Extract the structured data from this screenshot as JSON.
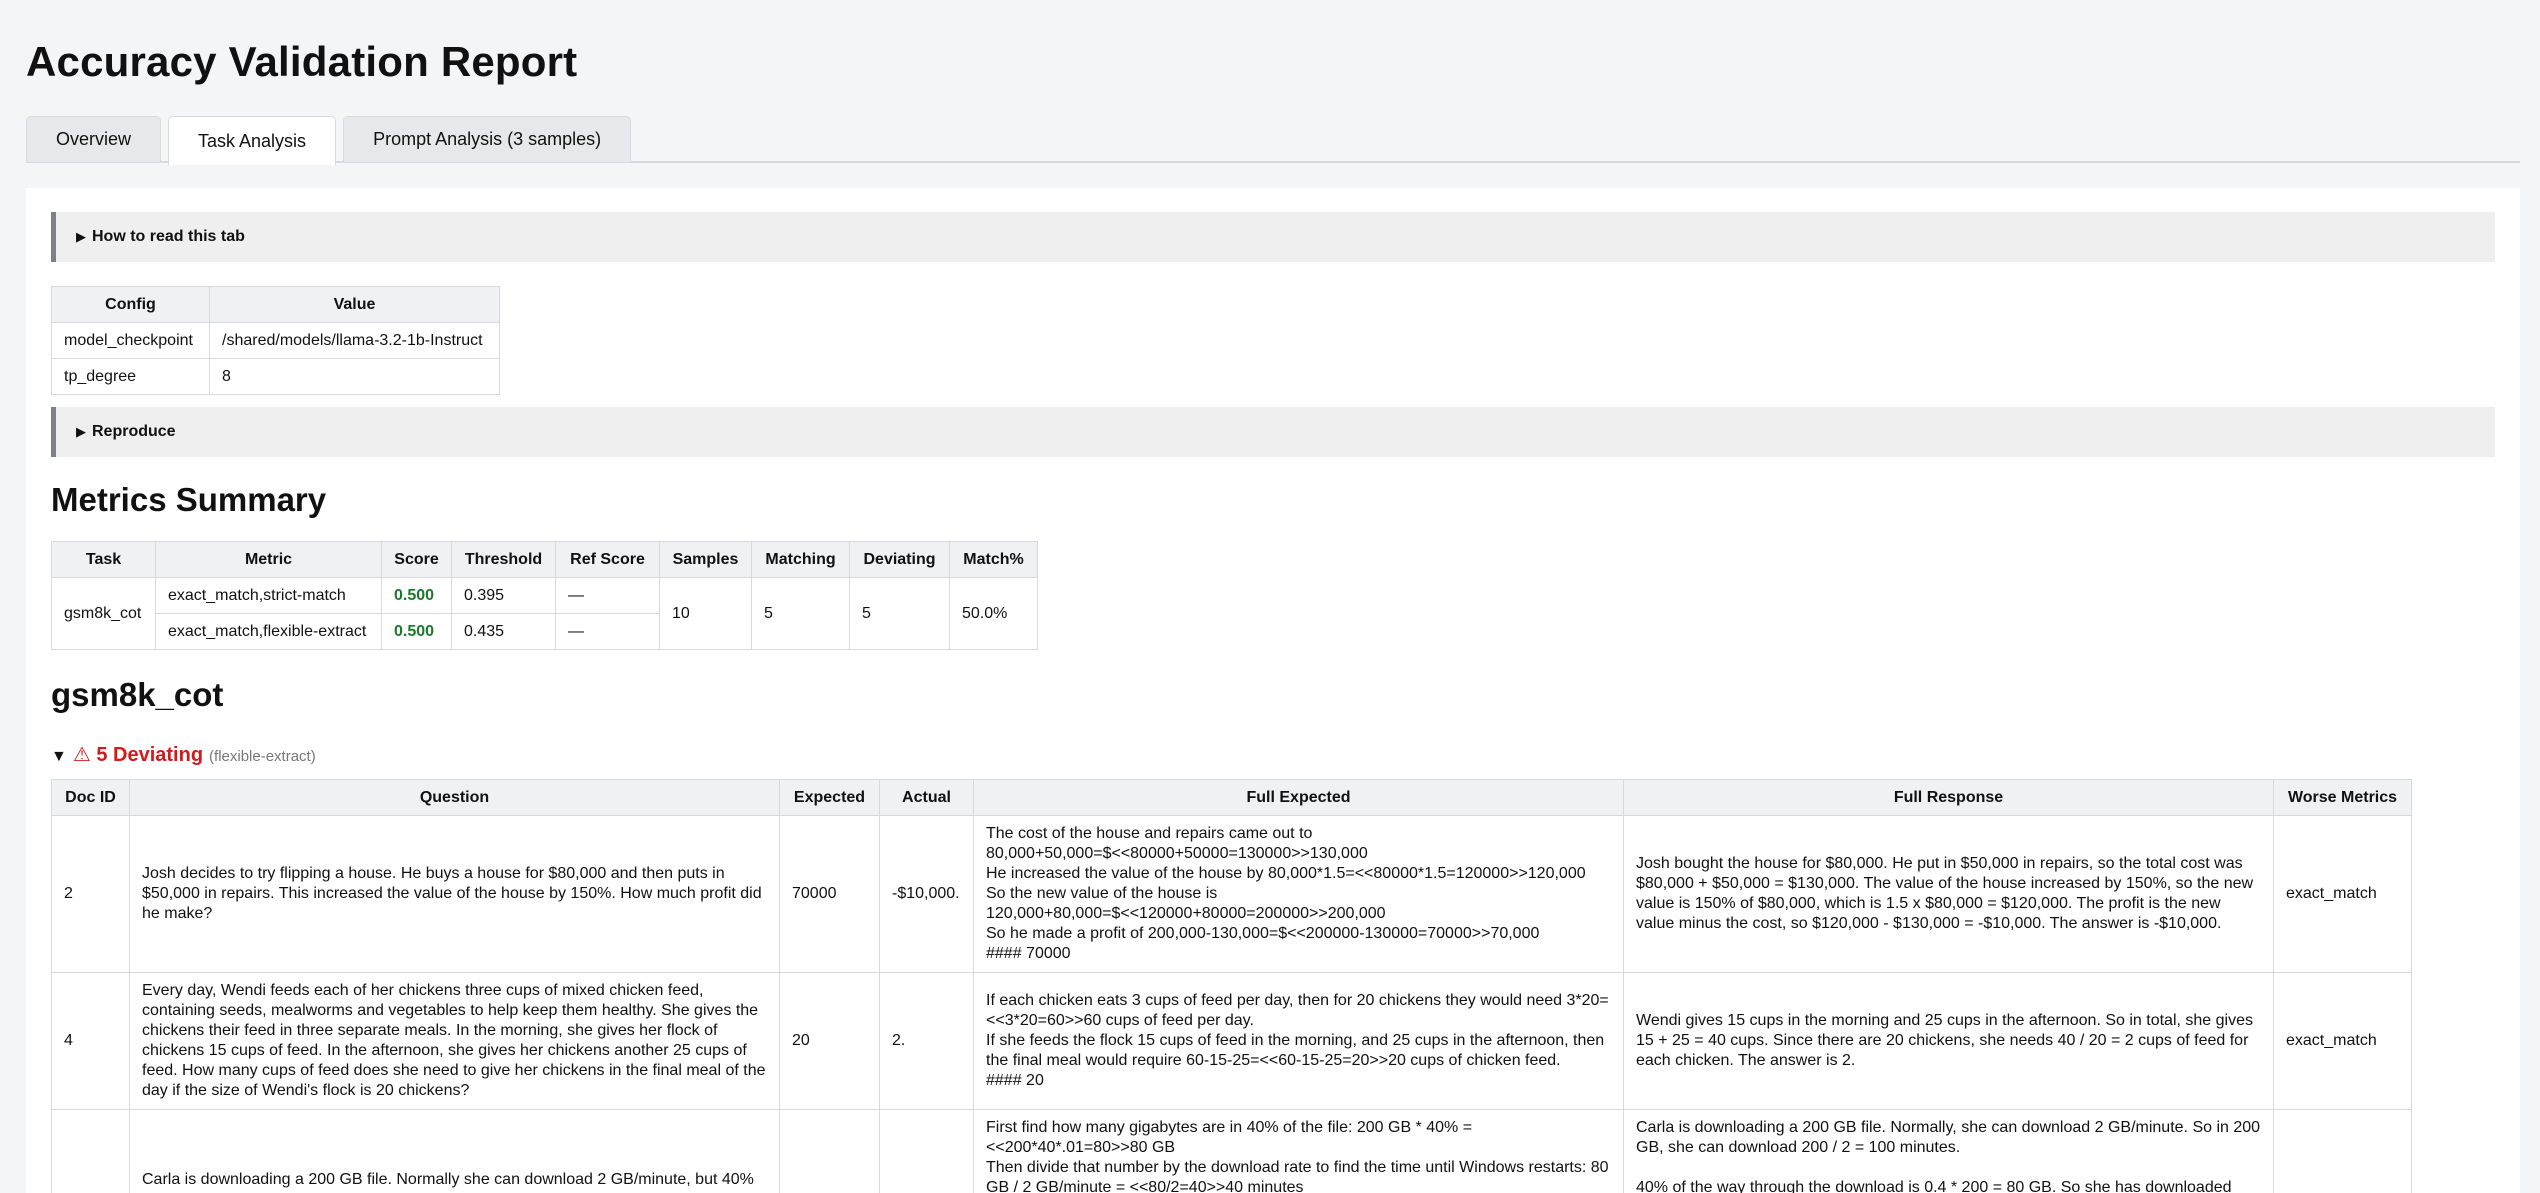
{
  "title": "Accuracy Validation Report",
  "tabs": [
    {
      "label": "Overview"
    },
    {
      "label": "Task Analysis"
    },
    {
      "label": "Prompt Analysis (3 samples)"
    }
  ],
  "how_to_read": {
    "arrow": "▶",
    "label": "How to read this tab"
  },
  "config": {
    "headers": [
      "Config",
      "Value"
    ],
    "rows": [
      {
        "key": "model_checkpoint",
        "value": "/shared/models/llama-3.2-1b-Instruct"
      },
      {
        "key": "tp_degree",
        "value": "8"
      }
    ]
  },
  "reproduce": {
    "arrow": "▶",
    "label": "Reproduce"
  },
  "metrics": {
    "title": "Metrics Summary",
    "headers": [
      "Task",
      "Metric",
      "Score",
      "Threshold",
      "Ref Score",
      "Samples",
      "Matching",
      "Deviating",
      "Match%"
    ],
    "task": "gsm8k_cot",
    "rows": [
      {
        "metric": "exact_match,strict-match",
        "score": "0.500",
        "threshold": "0.395",
        "ref": "—"
      },
      {
        "metric": "exact_match,flexible-extract",
        "score": "0.500",
        "threshold": "0.435",
        "ref": "—"
      }
    ],
    "samples": "10",
    "matching": "5",
    "deviating": "5",
    "match_pct": "50.0%",
    "score_color": "#1a7a2c"
  },
  "task_section": {
    "title": "gsm8k_cot",
    "toggle": "▼",
    "warning": "⚠ 5 Deviating",
    "subtitle": "(flexible-extract)",
    "warning_color": "#d11b1b",
    "headers": [
      "Doc ID",
      "Question",
      "Expected",
      "Actual",
      "Full Expected",
      "Full Response",
      "Worse Metrics"
    ],
    "rows": [
      {
        "doc_id": "2",
        "question": "Josh decides to try flipping a house.  He buys a house for $80,000 and then puts in $50,000 in repairs.  This increased the value of the house by 150%.  How much profit did he make?",
        "expected": "70000",
        "actual": "-$10,000.",
        "full_expected": "The cost of the house and repairs came out to 80,000+50,000=$<<80000+50000=130000>>130,000\nHe increased the value of the house by 80,000*1.5=<<80000*1.5=120000>>120,000\nSo the new value of the house is 120,000+80,000=$<<120000+80000=200000>>200,000\nSo he made a profit of 200,000-130,000=$<<200000-130000=70000>>70,000\n#### 70000",
        "full_response": "Josh bought the house for $80,000. He put in $50,000 in repairs, so the total cost was $80,000 + $50,000 = $130,000. The value of the house increased by 150%, so the new value is 150% of $80,000, which is 1.5 x $80,000 = $120,000. The profit is the new value minus the cost, so $120,000 - $130,000 = -$10,000. The answer is -$10,000.",
        "worse": "exact_match"
      },
      {
        "doc_id": "4",
        "question": "Every day, Wendi feeds each of her chickens three cups of mixed chicken feed, containing seeds, mealworms and vegetables to help keep them healthy.  She gives the chickens their feed in three separate meals. In the morning, she gives her flock of chickens 15 cups of feed.  In the afternoon, she gives her chickens another 25 cups of feed.  How many cups of feed does she need to give her chickens in the final meal of the day if the size of Wendi's flock is 20 chickens?",
        "expected": "20",
        "actual": "2.",
        "full_expected": "If each chicken eats 3 cups of feed per day, then for 20 chickens they would need 3*20=<<3*20=60>>60 cups of feed per day.\nIf she feeds the flock 15 cups of feed in the morning, and 25 cups in the afternoon, then the final meal would require 60-15-25=<<60-15-25=20>>20 cups of chicken feed.\n#### 20",
        "full_response": "Wendi gives 15 cups in the morning and 25 cups in the afternoon. So in total, she gives 15 + 25 = 40 cups. Since there are 20 chickens, she needs 40 / 20 = 2 cups of feed for each chicken. The answer is 2.",
        "worse": "exact_match"
      },
      {
        "doc_id": "",
        "question": "Carla is downloading a 200 GB file. Normally she can download 2 GB/minute, but 40%",
        "expected": "",
        "actual": "",
        "full_expected": "First find how many gigabytes are in 40% of the file: 200 GB * 40% = <<200*40*.01=80>>80 GB\nThen divide that number by the download rate to find the time until Windows restarts: 80 GB / 2 GB/minute = <<80/2=40>>40 minutes",
        "full_response": "Carla is downloading a 200 GB file. Normally, she can download 2 GB/minute. So in 200 GB, she can download 200 / 2 = 100 minutes.\n\n40% of the way through the download is 0.4 * 200 = 80 GB. So she has downloaded",
        "worse": ""
      }
    ]
  }
}
